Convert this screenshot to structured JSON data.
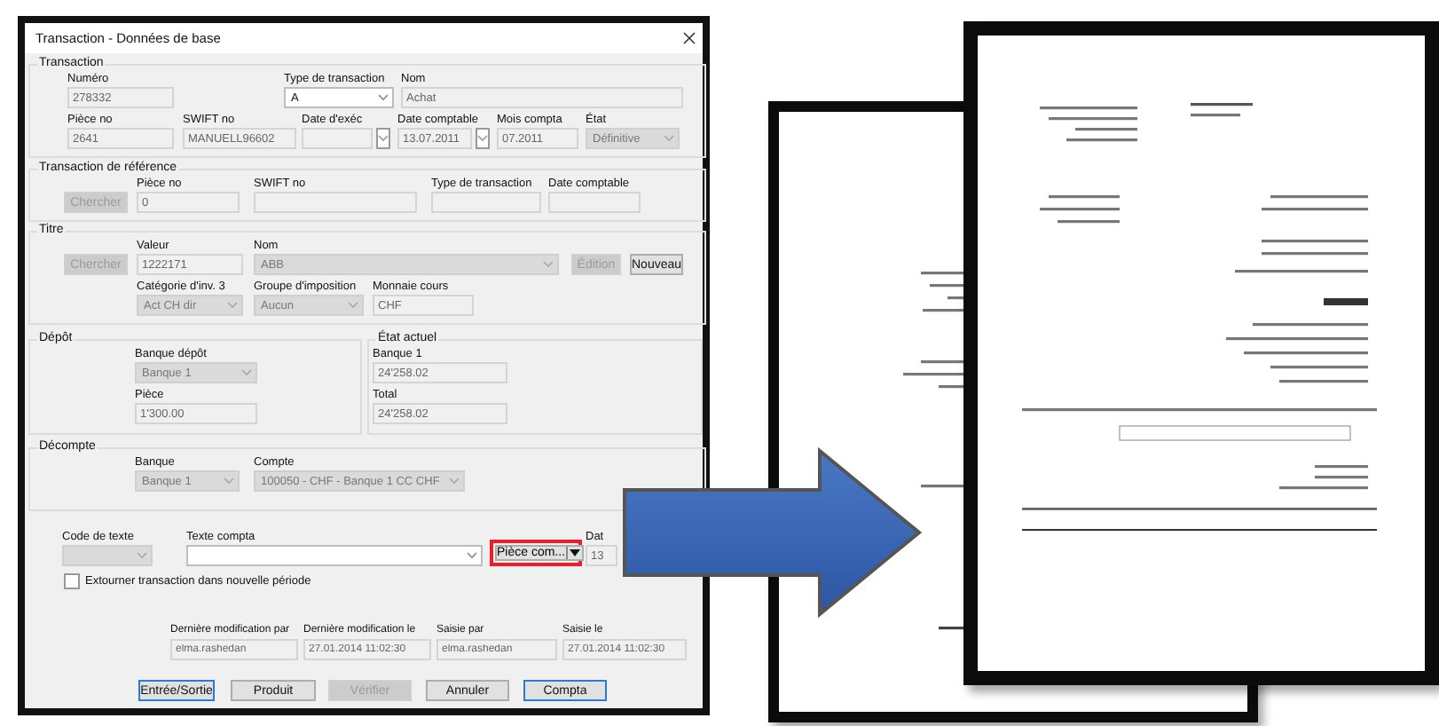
{
  "dialog": {
    "title": "Transaction - Données de base",
    "groups": [
      {
        "legend": "Transaction",
        "fields": [
          {
            "kind": "input",
            "label": "Numéro",
            "value": "278332",
            "disabled": true
          },
          {
            "kind": "select",
            "label": "Type de transaction",
            "value": "A",
            "disabled": false
          },
          {
            "kind": "input",
            "label": "Nom",
            "value": "Achat",
            "disabled": true
          },
          {
            "kind": "input",
            "label": "Pièce no",
            "value": "2641",
            "disabled": true
          },
          {
            "kind": "input",
            "label": "SWIFT no",
            "value": "MANUELL96602",
            "disabled": true
          },
          {
            "kind": "date",
            "label": "Date d'exéc",
            "disabled": true
          },
          {
            "kind": "date",
            "label": "Date comptable",
            "value": "13.07.2011",
            "disabled": true
          },
          {
            "kind": "input",
            "label": "Mois compta",
            "value": "07.2011",
            "disabled": true
          },
          {
            "kind": "select",
            "label": "État",
            "value": "Définitive",
            "disabled": true
          }
        ]
      },
      {
        "legend": "Transaction de référence",
        "fields": [
          {
            "kind": "button",
            "label": "Chercher",
            "disabled": true
          },
          {
            "kind": "input",
            "label": "Pièce no",
            "value": "0",
            "disabled": true
          },
          {
            "kind": "input",
            "label": "SWIFT no",
            "disabled": true
          },
          {
            "kind": "input",
            "label": "Type de transaction",
            "disabled": true
          },
          {
            "kind": "input",
            "label": "Date comptable",
            "disabled": true
          }
        ]
      },
      {
        "legend": "Titre",
        "fields": [
          {
            "kind": "button",
            "label": "Chercher",
            "disabled": true
          },
          {
            "kind": "input",
            "label": "Valeur",
            "value": "1222171",
            "disabled": true
          },
          {
            "kind": "select",
            "label": "Nom",
            "value": "ABB",
            "disabled": true
          },
          {
            "kind": "button",
            "label": "Édition",
            "disabled": true
          },
          {
            "kind": "button",
            "label": "Nouveau",
            "disabled": false
          },
          {
            "kind": "select",
            "label": "Catégorie d'inv. 3",
            "value": "Act CH dir",
            "disabled": true
          },
          {
            "kind": "select",
            "label": "Groupe d'imposition",
            "value": "Aucun",
            "disabled": true
          },
          {
            "kind": "input",
            "label": "Monnaie cours",
            "value": "CHF",
            "disabled": true
          }
        ]
      },
      {
        "legend": "Dépôt",
        "fields": [
          {
            "kind": "select",
            "label": "Banque dépôt",
            "value": "Banque 1",
            "disabled": true
          },
          {
            "kind": "input",
            "label": "Pièce",
            "value": "1'300.00",
            "disabled": true
          }
        ]
      },
      {
        "legend": "État actuel",
        "fields": [
          {
            "kind": "input",
            "label": "Banque 1",
            "value": "24'258.02",
            "disabled": true
          },
          {
            "kind": "input",
            "label": "Total",
            "value": "24'258.02",
            "disabled": true
          }
        ]
      },
      {
        "legend": "Décompte",
        "fields": [
          {
            "kind": "select",
            "label": "Banque",
            "value": "Banque 1",
            "disabled": true
          },
          {
            "kind": "select",
            "label": "Compte",
            "value": "100050 - CHF - Banque 1 CC CHF",
            "disabled": true
          }
        ]
      }
    ],
    "text_row": [
      {
        "kind": "select",
        "label": "Code de texte",
        "disabled": true
      },
      {
        "kind": "select",
        "label": "Texte compta",
        "disabled": false
      },
      {
        "kind": "split",
        "label": "Pièce com...",
        "highlighted": true
      },
      {
        "kind": "input",
        "label": "Dat",
        "value": "13",
        "disabled": true
      }
    ],
    "reverse_checkbox": {
      "label": "Extourner transaction dans nouvelle période",
      "checked": false
    },
    "info_row": [
      {
        "kind": "input",
        "label": "Dernière modification par",
        "value": "elma.rashedan",
        "disabled": true
      },
      {
        "kind": "input",
        "label": "Dernière modification le",
        "value": "27.01.2014 11:02:30",
        "disabled": true
      },
      {
        "kind": "input",
        "label": "Saisie par",
        "value": "elma.rashedan",
        "disabled": true
      },
      {
        "kind": "input",
        "label": "Saisie le",
        "value": "27.01.2014 11:02:30",
        "disabled": true
      }
    ],
    "buttons": [
      {
        "label": "Entrée/Sortie",
        "disabled": false,
        "focused": true
      },
      {
        "label": "Produit",
        "disabled": false,
        "focused": false
      },
      {
        "label": "Vérifier",
        "disabled": true,
        "focused": false
      },
      {
        "label": "Annuler",
        "disabled": false,
        "focused": false
      },
      {
        "label": "Compta",
        "disabled": false,
        "focused": true
      }
    ]
  }
}
